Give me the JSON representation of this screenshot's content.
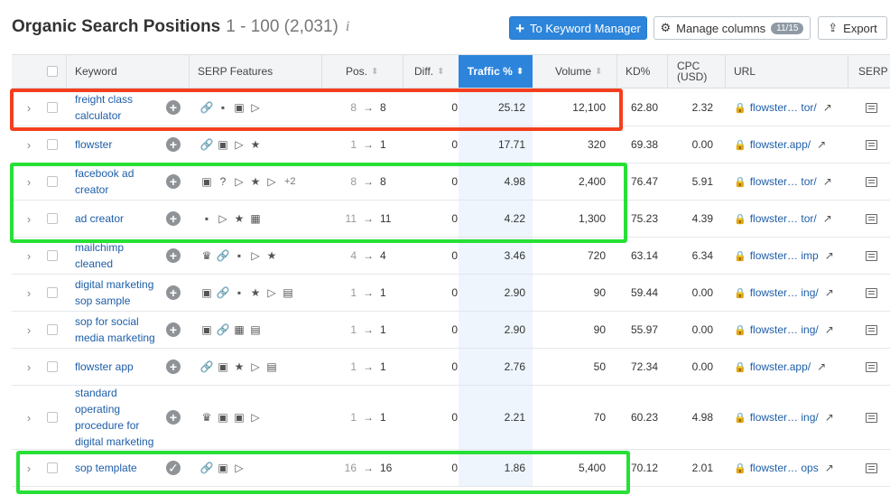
{
  "header": {
    "title": "Organic Search Positions",
    "range": "1 - 100 (2,031)",
    "info_icon": "i"
  },
  "buttons": {
    "keyword_manager": "To Keyword Manager",
    "manage_columns": "Manage columns",
    "columns_badge": "11/15",
    "export": "Export"
  },
  "columns": {
    "keyword": "Keyword",
    "serp_features": "SERP Features",
    "pos": "Pos.",
    "diff": "Diff.",
    "traffic": "Traffic %",
    "volume": "Volume",
    "kd": "KD%",
    "cpc_line1": "CPC",
    "cpc_line2": "(USD)",
    "url": "URL",
    "serp": "SERP"
  },
  "icon_glyphs": {
    "link": "🔗",
    "review": "▪",
    "image": "▣",
    "video": "▷",
    "star": "★",
    "faq": "?",
    "crown": "♛",
    "news": "▦",
    "carousel": "▤",
    "check": "✓",
    "plus": "+"
  },
  "rows": [
    {
      "keyword_lines": [
        "freight class",
        "calculator"
      ],
      "add_type": "plus",
      "serp": [
        "link-icon",
        "review-icon",
        "image-icon",
        "video-icon"
      ],
      "more": "",
      "pos_from": "8",
      "pos_to": "8",
      "diff": "0",
      "traffic": "25.12",
      "volume": "12,100",
      "kd": "62.80",
      "cpc": "2.32",
      "url": "flowster… tor/"
    },
    {
      "keyword_lines": [
        "flowster"
      ],
      "add_type": "plus",
      "serp": [
        "link-icon",
        "image-icon",
        "video-icon",
        "star-icon"
      ],
      "more": "",
      "pos_from": "1",
      "pos_to": "1",
      "diff": "0",
      "traffic": "17.71",
      "volume": "320",
      "kd": "69.38",
      "cpc": "0.00",
      "url": "flowster.app/"
    },
    {
      "keyword_lines": [
        "facebook ad",
        "creator"
      ],
      "add_type": "plus",
      "serp": [
        "image-icon",
        "faq-icon",
        "video-icon",
        "star-icon",
        "video-icon"
      ],
      "more": "+2",
      "pos_from": "8",
      "pos_to": "8",
      "diff": "0",
      "traffic": "4.98",
      "volume": "2,400",
      "kd": "76.47",
      "cpc": "5.91",
      "url": "flowster… tor/"
    },
    {
      "keyword_lines": [
        "ad creator"
      ],
      "add_type": "plus",
      "serp": [
        "review-icon",
        "video-icon",
        "star-icon",
        "news-icon"
      ],
      "more": "",
      "pos_from": "11",
      "pos_to": "11",
      "diff": "0",
      "traffic": "4.22",
      "volume": "1,300",
      "kd": "75.23",
      "cpc": "4.39",
      "url": "flowster… tor/"
    },
    {
      "keyword_lines": [
        "mailchimp",
        "cleaned"
      ],
      "add_type": "plus",
      "serp": [
        "crown-icon",
        "link-icon",
        "review-icon",
        "video-icon",
        "star-icon"
      ],
      "more": "",
      "pos_from": "4",
      "pos_to": "4",
      "diff": "0",
      "traffic": "3.46",
      "volume": "720",
      "kd": "63.14",
      "cpc": "6.34",
      "url": "flowster… imp"
    },
    {
      "keyword_lines": [
        "digital marketing",
        "sop sample"
      ],
      "add_type": "plus",
      "serp": [
        "image-icon",
        "link-icon",
        "review-icon",
        "star-icon",
        "video-icon",
        "carousel-icon"
      ],
      "more": "",
      "pos_from": "1",
      "pos_to": "1",
      "diff": "0",
      "traffic": "2.90",
      "volume": "90",
      "kd": "59.44",
      "cpc": "0.00",
      "url": "flowster… ing/"
    },
    {
      "keyword_lines": [
        "sop for social",
        "media marketing"
      ],
      "add_type": "plus",
      "serp": [
        "image-icon",
        "link-icon",
        "news-icon",
        "carousel-icon"
      ],
      "more": "",
      "pos_from": "1",
      "pos_to": "1",
      "diff": "0",
      "traffic": "2.90",
      "volume": "90",
      "kd": "55.97",
      "cpc": "0.00",
      "url": "flowster… ing/"
    },
    {
      "keyword_lines": [
        "flowster app"
      ],
      "add_type": "plus",
      "serp": [
        "link-icon",
        "image-icon",
        "star-icon",
        "video-icon",
        "carousel-icon"
      ],
      "more": "",
      "pos_from": "1",
      "pos_to": "1",
      "diff": "0",
      "traffic": "2.76",
      "volume": "50",
      "kd": "72.34",
      "cpc": "0.00",
      "url": "flowster.app/"
    },
    {
      "keyword_lines": [
        "standard",
        "operating",
        "procedure for",
        "digital marketing"
      ],
      "add_type": "plus",
      "serp": [
        "crown-icon",
        "image-icon",
        "image-icon",
        "video-icon"
      ],
      "more": "",
      "pos_from": "1",
      "pos_to": "1",
      "diff": "0",
      "traffic": "2.21",
      "volume": "70",
      "kd": "60.23",
      "cpc": "4.98",
      "url": "flowster… ing/"
    },
    {
      "keyword_lines": [
        "sop template"
      ],
      "add_type": "check",
      "serp": [
        "link-icon",
        "image-icon",
        "video-icon"
      ],
      "more": "",
      "pos_from": "16",
      "pos_to": "16",
      "diff": "0",
      "traffic": "1.86",
      "volume": "5,400",
      "kd": "70.12",
      "cpc": "2.01",
      "url": "flowster… ops"
    }
  ],
  "highlight_colors": {
    "red": "#f43f1f",
    "green": "#27e036"
  }
}
